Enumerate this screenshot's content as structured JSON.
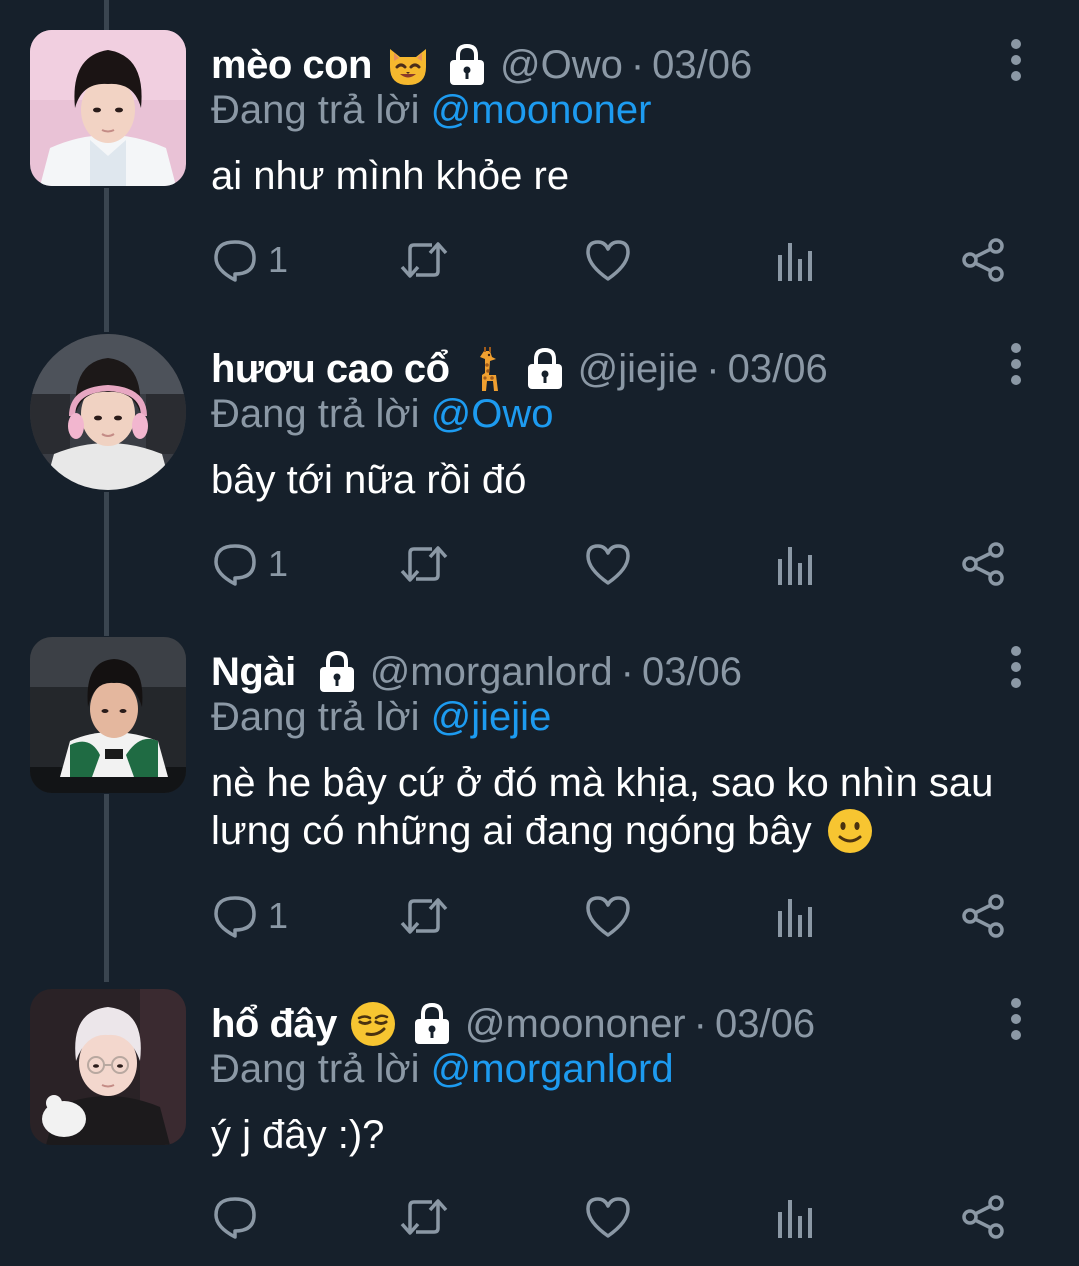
{
  "tweets": [
    {
      "name": "mèo con",
      "emoji": "cat-face-emoji",
      "handle": "@Owo",
      "separator": "·",
      "date": "03/06",
      "reply_prefix": "Đang trả lời",
      "reply_to": "@moononer",
      "text": "ai như mình khỏe re",
      "reply_count": "1"
    },
    {
      "name": "hươu cao cổ",
      "emoji": "giraffe-emoji",
      "handle": "@jiejie",
      "separator": "·",
      "date": "03/06",
      "reply_prefix": "Đang trả lời",
      "reply_to": "@Owo",
      "text": "bây tới nữa rồi đó",
      "reply_count": "1"
    },
    {
      "name": "Ngài",
      "emoji": "",
      "handle": "@morganlord",
      "separator": "·",
      "date": "03/06",
      "reply_prefix": "Đang trả lời",
      "reply_to": "@jiejie",
      "text_line1": "nè he bây cứ ở đó mà khịa, sao ko nhìn sau",
      "text_line2": "lưng có những ai đang ngóng bây",
      "reply_count": "1"
    },
    {
      "name": "hổ đây",
      "emoji": "smirking-face-emoji",
      "handle": "@moononer",
      "separator": "·",
      "date": "03/06",
      "reply_prefix": "Đang trả lời",
      "reply_to": "@morganlord",
      "text": "ý j đây :)?",
      "reply_count": ""
    }
  ],
  "colors": {
    "background": "#16202b",
    "text_primary": "#ffffff",
    "text_secondary": "#8b98a5",
    "mention": "#1d9bf0",
    "thread_line": "#3a4550"
  },
  "icons": [
    "reply-icon",
    "retweet-icon",
    "like-icon",
    "analytics-icon",
    "share-icon",
    "lock-icon",
    "more-options-icon"
  ]
}
